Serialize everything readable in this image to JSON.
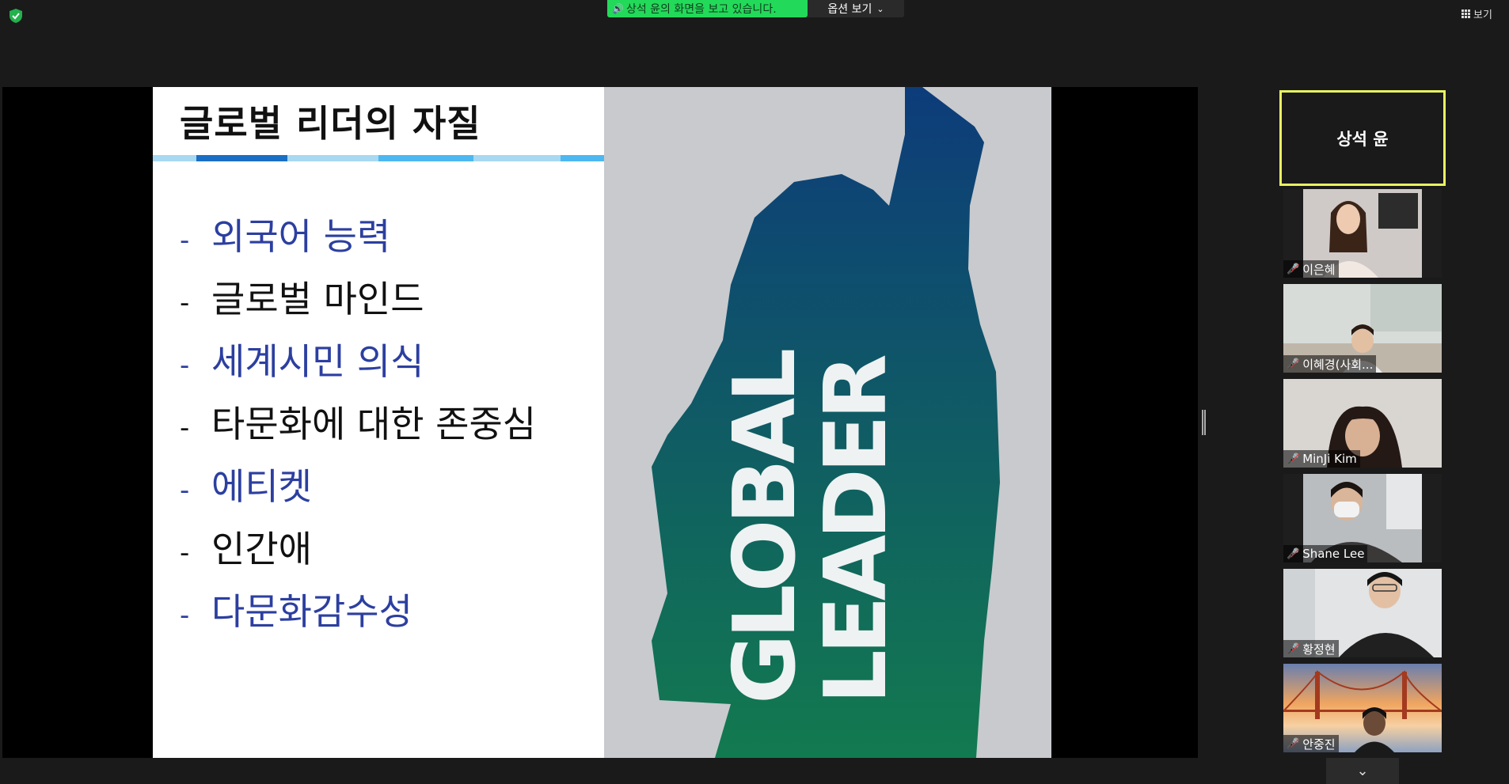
{
  "topbar": {
    "share_banner": "상석 윤의 화면을 보고 있습니다.",
    "options_label": "옵션 보기",
    "view_label": "보기"
  },
  "slide": {
    "title": "글로벌 리더의 자질",
    "bullets": [
      {
        "text": "외국어 능력",
        "color": "#2c3fa0"
      },
      {
        "text": "글로벌 마인드",
        "color": "#111111"
      },
      {
        "text": "세계시민 의식",
        "color": "#2c3fa0"
      },
      {
        "text": "타문화에 대한 존중심",
        "color": "#111111"
      },
      {
        "text": "에티켓",
        "color": "#2c3fa0"
      },
      {
        "text": "인간애",
        "color": "#111111"
      },
      {
        "text": "다문화감수성",
        "color": "#2c3fa0"
      }
    ],
    "dash": "-",
    "image_text_line1": "GLOBAL",
    "image_text_line2": "LEADER",
    "accent_colors": [
      "#1a6fc4",
      "#4db8f0",
      "#a8d8f2"
    ],
    "silhouette_gradient": [
      "#0d3c7a",
      "#127a4f"
    ]
  },
  "participants": {
    "active_speaker": "상석 윤",
    "tiles": [
      {
        "name": "이은혜",
        "muted": true,
        "bg": "#cfcac8"
      },
      {
        "name": "이혜경(사회...",
        "muted": true,
        "bg": "#d7dcd8"
      },
      {
        "name": "MinJi Kim",
        "muted": true,
        "bg": "#d9d6d2"
      },
      {
        "name": "Shane Lee",
        "muted": true,
        "bg": "#b9bdc0"
      },
      {
        "name": "황정현",
        "muted": true,
        "bg": "#e2e4e6"
      },
      {
        "name": "안중진",
        "muted": true,
        "bg": "#f0a560"
      }
    ],
    "scroll_icon": "chevron-down-icon"
  }
}
